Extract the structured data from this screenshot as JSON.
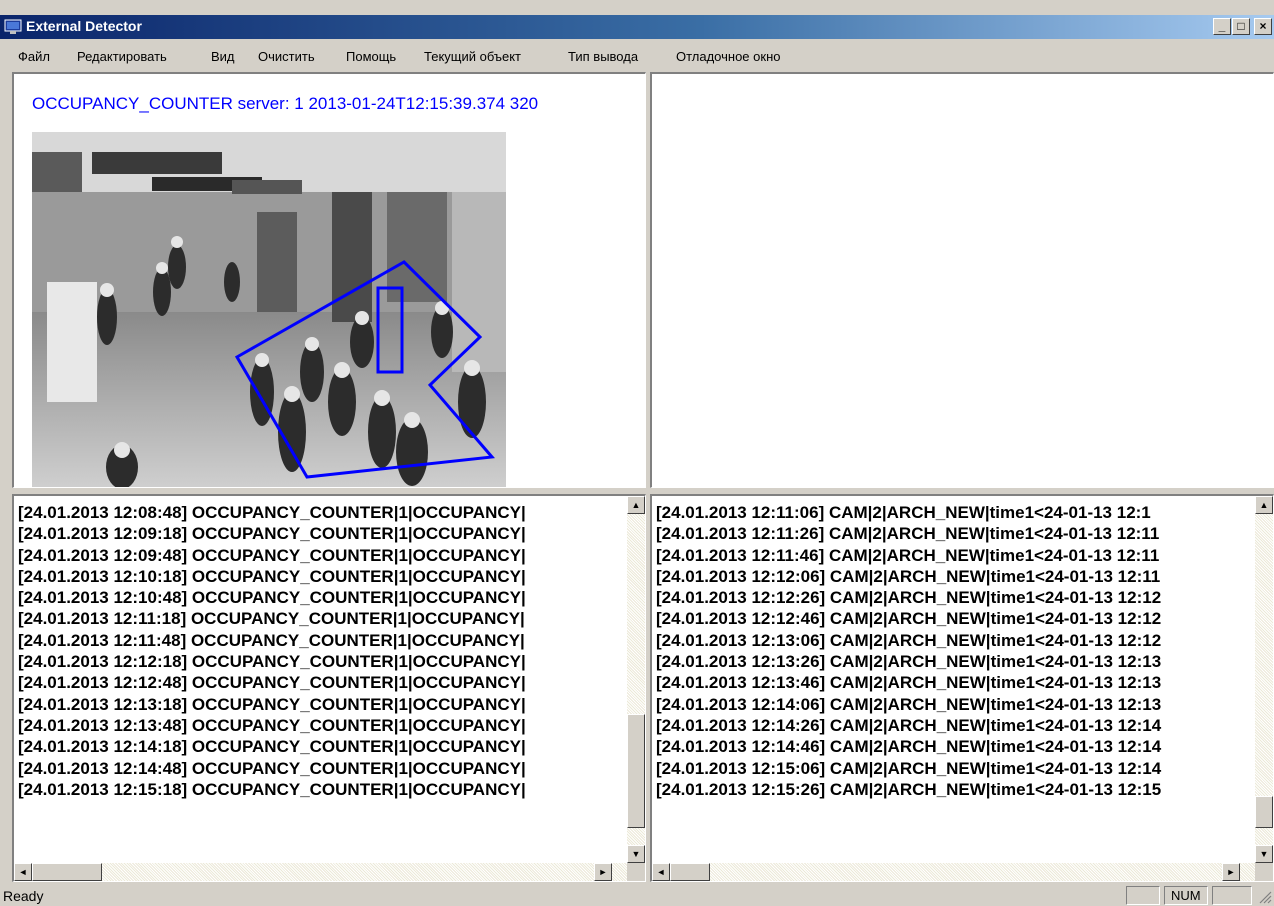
{
  "window": {
    "title": "External Detector"
  },
  "menu": [
    "Файл",
    "Редактировать",
    "Вид",
    "Очистить",
    "Помощь",
    "Текущий объект",
    "Тип вывода",
    "Отладочное окно"
  ],
  "video": {
    "header": "OCCUPANCY_COUNTER server: 1 2013-01-24T12:15:39.374 320"
  },
  "log_left": [
    "[24.01.2013 12:08:48] OCCUPANCY_COUNTER|1|OCCUPANCY|",
    "[24.01.2013 12:09:18] OCCUPANCY_COUNTER|1|OCCUPANCY|",
    "[24.01.2013 12:09:48] OCCUPANCY_COUNTER|1|OCCUPANCY|",
    "[24.01.2013 12:10:18] OCCUPANCY_COUNTER|1|OCCUPANCY|",
    "[24.01.2013 12:10:48] OCCUPANCY_COUNTER|1|OCCUPANCY|",
    "[24.01.2013 12:11:18] OCCUPANCY_COUNTER|1|OCCUPANCY|",
    "[24.01.2013 12:11:48] OCCUPANCY_COUNTER|1|OCCUPANCY|",
    "[24.01.2013 12:12:18] OCCUPANCY_COUNTER|1|OCCUPANCY|",
    "[24.01.2013 12:12:48] OCCUPANCY_COUNTER|1|OCCUPANCY|",
    "[24.01.2013 12:13:18] OCCUPANCY_COUNTER|1|OCCUPANCY|",
    "[24.01.2013 12:13:48] OCCUPANCY_COUNTER|1|OCCUPANCY|",
    "[24.01.2013 12:14:18] OCCUPANCY_COUNTER|1|OCCUPANCY|",
    "[24.01.2013 12:14:48] OCCUPANCY_COUNTER|1|OCCUPANCY|",
    "[24.01.2013 12:15:18] OCCUPANCY_COUNTER|1|OCCUPANCY|"
  ],
  "log_right": [
    "[24.01.2013 12:11:06] CAM|2|ARCH_NEW|time1<24-01-13 12:1",
    "[24.01.2013 12:11:26] CAM|2|ARCH_NEW|time1<24-01-13 12:11",
    "[24.01.2013 12:11:46] CAM|2|ARCH_NEW|time1<24-01-13 12:11",
    "[24.01.2013 12:12:06] CAM|2|ARCH_NEW|time1<24-01-13 12:11",
    "[24.01.2013 12:12:26] CAM|2|ARCH_NEW|time1<24-01-13 12:12",
    "[24.01.2013 12:12:46] CAM|2|ARCH_NEW|time1<24-01-13 12:12",
    "[24.01.2013 12:13:06] CAM|2|ARCH_NEW|time1<24-01-13 12:12",
    "[24.01.2013 12:13:26] CAM|2|ARCH_NEW|time1<24-01-13 12:13",
    "[24.01.2013 12:13:46] CAM|2|ARCH_NEW|time1<24-01-13 12:13",
    "[24.01.2013 12:14:06] CAM|2|ARCH_NEW|time1<24-01-13 12:13",
    "[24.01.2013 12:14:26] CAM|2|ARCH_NEW|time1<24-01-13 12:14",
    "[24.01.2013 12:14:46] CAM|2|ARCH_NEW|time1<24-01-13 12:14",
    "[24.01.2013 12:15:06] CAM|2|ARCH_NEW|time1<24-01-13 12:14",
    "[24.01.2013 12:15:26] CAM|2|ARCH_NEW|time1<24-01-13 12:15"
  ],
  "status": {
    "text": "Ready",
    "num": "NUM"
  },
  "colors": {
    "titlebar": "#0a246a",
    "detection_zone": "#0000ff",
    "header_text": "#0000ff"
  },
  "icons": {
    "app": "monitor-icon",
    "minimize": "minimize-icon",
    "maximize": "maximize-icon",
    "close": "close-icon"
  }
}
